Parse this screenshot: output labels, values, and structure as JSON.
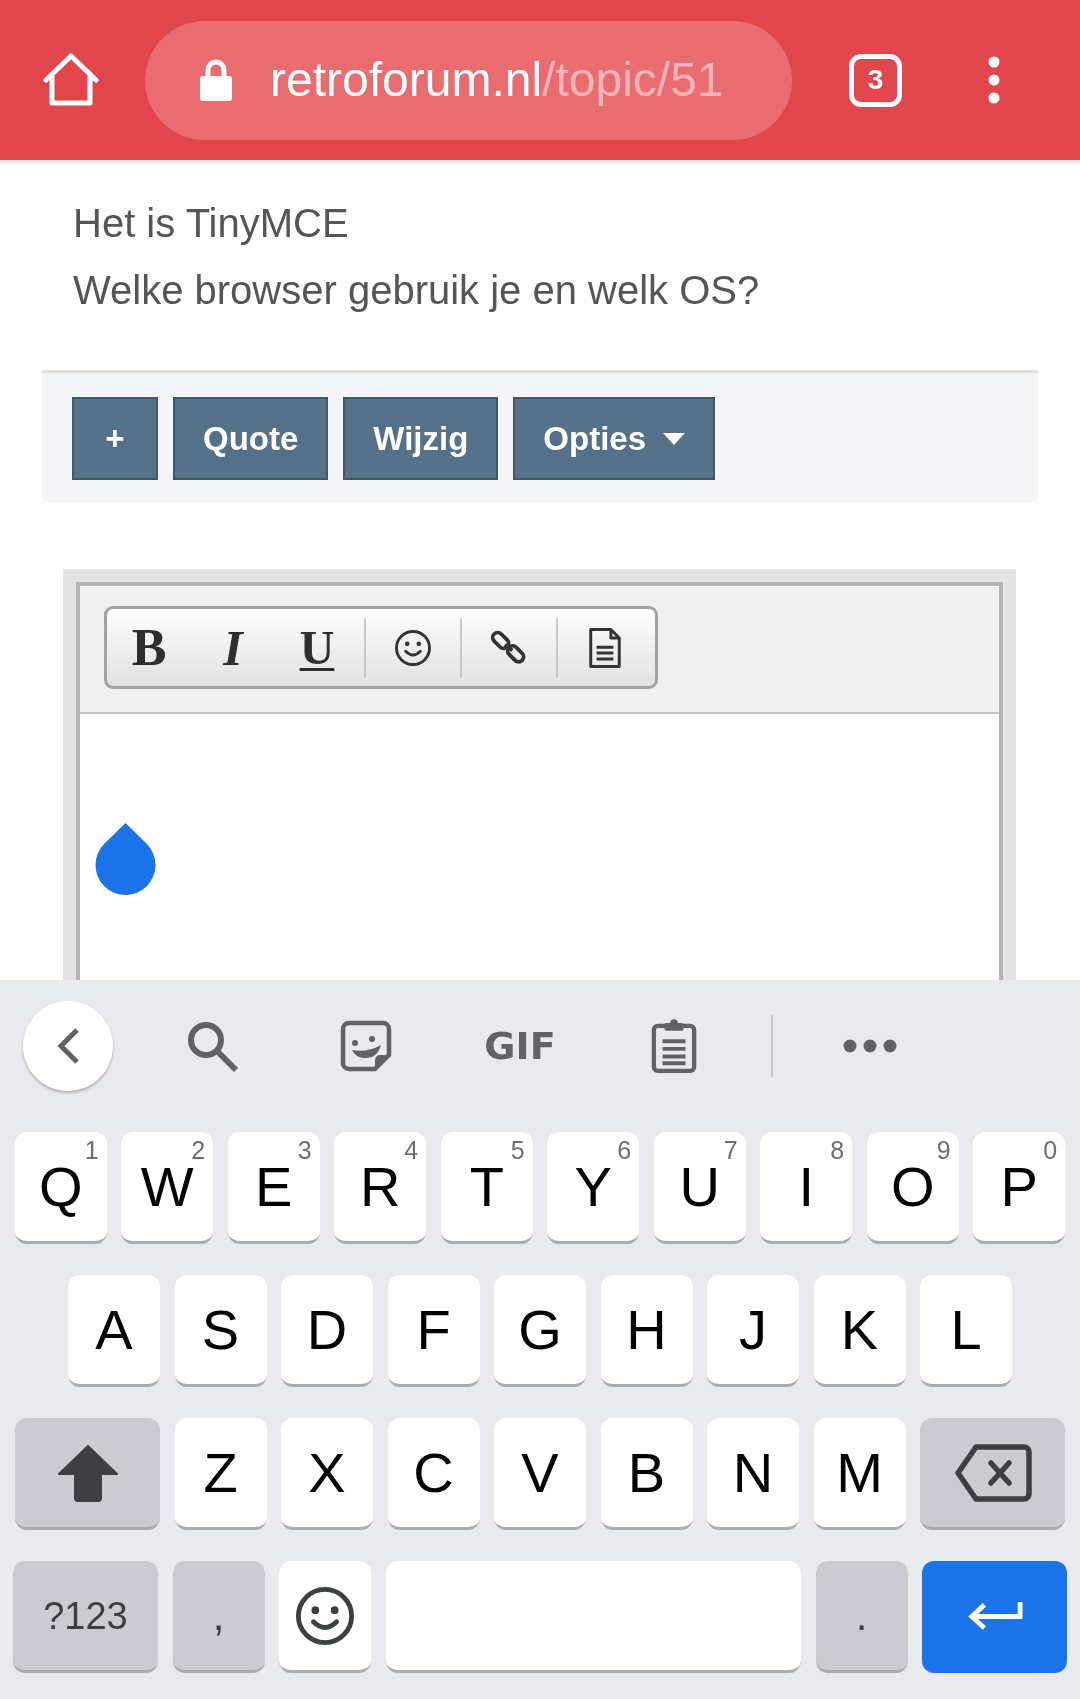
{
  "browser_bar": {
    "url": {
      "host": "retroforum.nl",
      "path": "/topic/51"
    },
    "tab_count": "3"
  },
  "post": {
    "lines": [
      "Het is TinyMCE",
      "Welke browser gebruik je en welk OS?"
    ]
  },
  "post_actions": [
    {
      "kind": "plain",
      "label": "+"
    },
    {
      "kind": "plain",
      "label": "Quote"
    },
    {
      "kind": "plain",
      "label": "Wijzig"
    },
    {
      "kind": "dropdown",
      "label": "Opties"
    }
  ],
  "editor": {
    "toolbar_groups": [
      [
        {
          "kind": "bold",
          "label": "B"
        },
        {
          "kind": "italic",
          "label": "I"
        },
        {
          "kind": "underline",
          "label": "U"
        }
      ],
      [
        {
          "kind": "emoji"
        }
      ],
      [
        {
          "kind": "link"
        }
      ],
      [
        {
          "kind": "document"
        }
      ]
    ]
  },
  "keyboard": {
    "toolbar": [
      {
        "kind": "collapse"
      },
      {
        "kind": "search"
      },
      {
        "kind": "sticker"
      },
      {
        "kind": "gif",
        "label": "GIF"
      },
      {
        "kind": "clipboard"
      },
      {
        "kind": "divider"
      },
      {
        "kind": "more"
      }
    ],
    "rows": [
      {
        "keys": [
          {
            "kind": "letter",
            "label": "Q",
            "hint": "1"
          },
          {
            "kind": "letter",
            "label": "W",
            "hint": "2"
          },
          {
            "kind": "letter",
            "label": "E",
            "hint": "3"
          },
          {
            "kind": "letter",
            "label": "R",
            "hint": "4"
          },
          {
            "kind": "letter",
            "label": "T",
            "hint": "5"
          },
          {
            "kind": "letter",
            "label": "Y",
            "hint": "6"
          },
          {
            "kind": "letter",
            "label": "U",
            "hint": "7"
          },
          {
            "kind": "letter",
            "label": "I",
            "hint": "8"
          },
          {
            "kind": "letter",
            "label": "O",
            "hint": "9"
          },
          {
            "kind": "letter",
            "label": "P",
            "hint": "0"
          }
        ]
      },
      {
        "keys": [
          {
            "kind": "letter",
            "label": "A"
          },
          {
            "kind": "letter",
            "label": "S"
          },
          {
            "kind": "letter",
            "label": "D"
          },
          {
            "kind": "letter",
            "label": "F"
          },
          {
            "kind": "letter",
            "label": "G"
          },
          {
            "kind": "letter",
            "label": "H"
          },
          {
            "kind": "letter",
            "label": "J"
          },
          {
            "kind": "letter",
            "label": "K"
          },
          {
            "kind": "letter",
            "label": "L"
          }
        ]
      },
      {
        "keys": [
          {
            "kind": "shift"
          },
          {
            "kind": "letter",
            "label": "Z"
          },
          {
            "kind": "letter",
            "label": "X"
          },
          {
            "kind": "letter",
            "label": "C"
          },
          {
            "kind": "letter",
            "label": "V"
          },
          {
            "kind": "letter",
            "label": "B"
          },
          {
            "kind": "letter",
            "label": "N"
          },
          {
            "kind": "letter",
            "label": "M"
          },
          {
            "kind": "backspace"
          }
        ]
      },
      {
        "keys": [
          {
            "kind": "symbols",
            "label": "?123"
          },
          {
            "kind": "punct",
            "label": ","
          },
          {
            "kind": "emoji"
          },
          {
            "kind": "space"
          },
          {
            "kind": "punct",
            "label": "."
          },
          {
            "kind": "enter"
          }
        ]
      }
    ]
  }
}
